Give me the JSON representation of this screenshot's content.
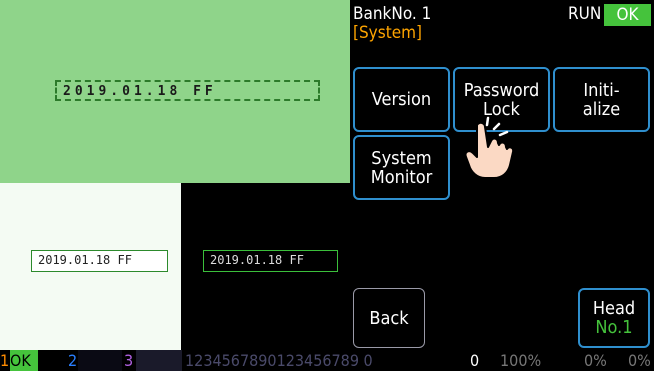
{
  "header": {
    "bank_label": "BankNo. 1",
    "section": "[System]",
    "run_label": "RUN",
    "ok_label": "OK"
  },
  "preview": {
    "top_text": "2019.01.18 FF",
    "bottom_left_text": "2019.01.18 FF",
    "bottom_right_text": "2019.01.18 FF"
  },
  "menu": {
    "version": "Version",
    "password_line1": "Password",
    "password_line2": "Lock",
    "init_line1": "Initi-",
    "init_line2": "alize",
    "sysmon_line1": "System",
    "sysmon_line2": "Monitor",
    "back": "Back",
    "head_line1": "Head",
    "head_line2": "No.1"
  },
  "status": {
    "n1": "1",
    "ok": "OK",
    "n2": "2",
    "n3": "3",
    "digits": "1234567890123456789 0",
    "zero": "0",
    "pct1": "100%",
    "pct2": "0%",
    "pct3": "0%"
  },
  "colors": {
    "accent_green": "#45c33c",
    "button_border": "#2f8fce",
    "section_orange": "#ffa500"
  },
  "icons": [
    "hand-pointer-icon"
  ]
}
